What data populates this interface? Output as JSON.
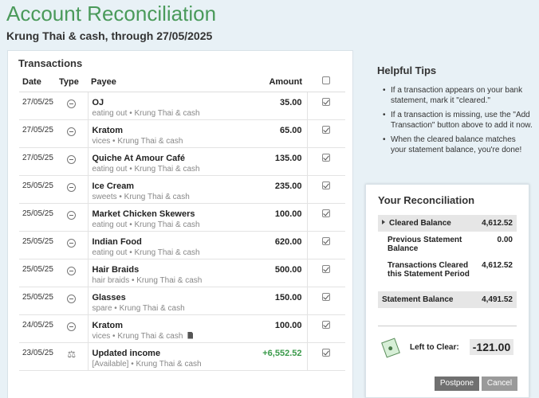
{
  "header": {
    "title": "Account Reconciliation",
    "subtitle": "Krung Thai & cash, through 27/05/2025"
  },
  "transactions": {
    "title": "Transactions",
    "columns": {
      "date": "Date",
      "type": "Type",
      "payee": "Payee",
      "amount": "Amount"
    },
    "rows": [
      {
        "date": "27/05/25",
        "type": "expense",
        "payee": "OJ",
        "sub": "eating out • Krung Thai & cash",
        "amount": "35.00",
        "checked": true
      },
      {
        "date": "27/05/25",
        "type": "expense",
        "payee": "Kratom",
        "sub": "vices • Krung Thai & cash",
        "amount": "65.00",
        "checked": true
      },
      {
        "date": "27/05/25",
        "type": "expense",
        "payee": "Quiche At Amour Café",
        "sub": "eating out • Krung Thai & cash",
        "amount": "135.00",
        "checked": true
      },
      {
        "date": "25/05/25",
        "type": "expense",
        "payee": "Ice Cream",
        "sub": "sweets • Krung Thai & cash",
        "amount": "235.00",
        "checked": true
      },
      {
        "date": "25/05/25",
        "type": "expense",
        "payee": "Market Chicken Skewers",
        "sub": "eating out • Krung Thai & cash",
        "amount": "100.00",
        "checked": true
      },
      {
        "date": "25/05/25",
        "type": "expense",
        "payee": "Indian Food",
        "sub": "eating out • Krung Thai & cash",
        "amount": "620.00",
        "checked": true
      },
      {
        "date": "25/05/25",
        "type": "expense",
        "payee": "Hair Braids",
        "sub": "hair braids • Krung Thai & cash",
        "amount": "500.00",
        "checked": true
      },
      {
        "date": "25/05/25",
        "type": "expense",
        "payee": "Glasses",
        "sub": "spare • Krung Thai & cash",
        "amount": "150.00",
        "checked": true
      },
      {
        "date": "24/05/25",
        "type": "expense",
        "payee": "Kratom",
        "sub": "vices • Krung Thai & cash",
        "amount": "100.00",
        "checked": true,
        "attachment": true
      },
      {
        "date": "23/05/25",
        "type": "income",
        "payee": "Updated income",
        "sub": "[Available] • Krung Thai & cash",
        "amount": "+6,552.52",
        "checked": true
      }
    ]
  },
  "tips": {
    "title": "Helpful Tips",
    "items": [
      "If a transaction appears on your bank statement, mark it \"cleared.\"",
      "If a transaction is missing, use the \"Add Transaction\" button above to add it now.",
      "When the cleared balance matches your statement balance, you're done!"
    ]
  },
  "reconciliation": {
    "title": "Your Reconciliation",
    "cleared_balance_label": "Cleared Balance",
    "cleared_balance_value": "4,612.52",
    "previous_label": "Previous Statement Balance",
    "previous_value": "0.00",
    "period_label": "Transactions Cleared this Statement Period",
    "period_value": "4,612.52",
    "statement_label": "Statement Balance",
    "statement_value": "4,491.52",
    "left_label": "Left to Clear:",
    "left_value": "-121.00",
    "postpone_label": "Postpone",
    "cancel_label": "Cancel"
  },
  "colors": {
    "title_green": "#4a9a5a",
    "income_green": "#3a9a4a",
    "background": "#e8f1f6"
  }
}
